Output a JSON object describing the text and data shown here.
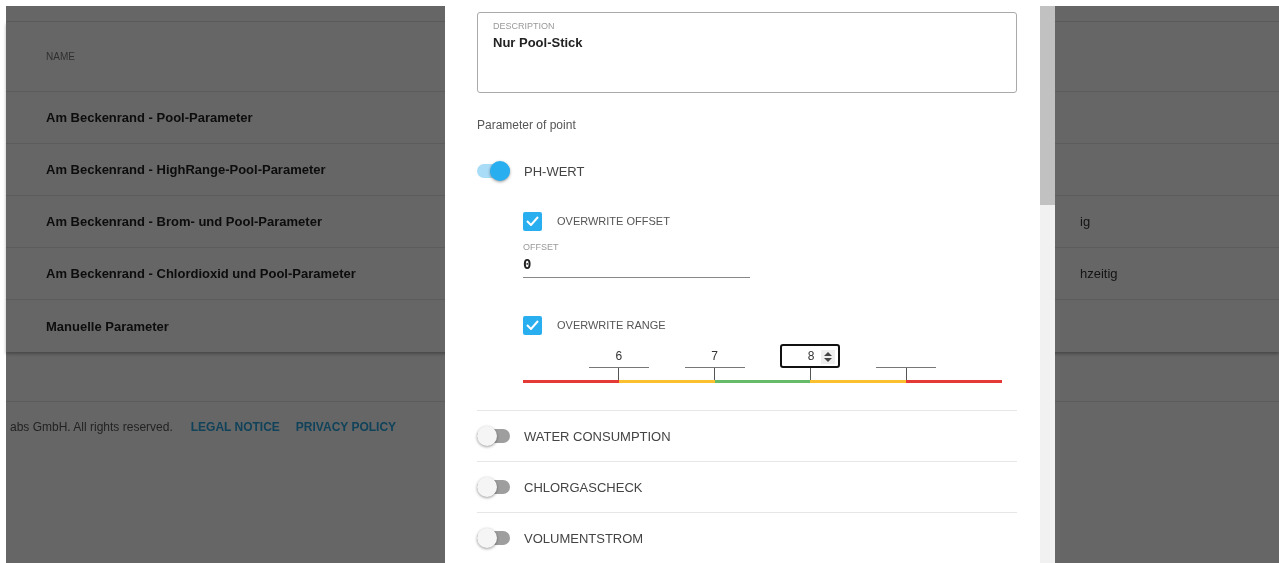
{
  "background_table": {
    "columns": [
      "NAME"
    ],
    "rows": [
      {
        "name": "Am Beckenrand - Pool-Parameter"
      },
      {
        "name": "Am Beckenrand - HighRange-Pool-Parameter"
      },
      {
        "name": "Am Beckenrand - Brom- und Pool-Parameter",
        "column_2": "ig"
      },
      {
        "name": "Am Beckenrand - Chlordioxid und Pool-Parameter",
        "column_2": "hzeitig"
      },
      {
        "name": "Manuelle Parameter"
      }
    ]
  },
  "footer": {
    "copyright": "abs GmbH. All rights reserved.",
    "links": [
      "LEGAL NOTICE",
      "PRIVACY POLICY"
    ]
  },
  "dialog": {
    "description": {
      "label": "DESCRIPTION",
      "value": "Nur Pool-Stick"
    },
    "section_label": "Parameter of point",
    "parameters": [
      {
        "name": "PH-WERT",
        "on": true,
        "overwrite_offset": {
          "label": "OVERWRITE OFFSET",
          "checked": true
        },
        "offset": {
          "label": "OFFSET",
          "value": "0"
        },
        "overwrite_range": {
          "label": "OVERWRITE RANGE",
          "checked": true
        },
        "range": {
          "thresholds": [
            {
              "value": "6",
              "focused": false
            },
            {
              "value": "7",
              "focused": false
            },
            {
              "value": "8",
              "focused": true
            },
            {
              "focused": false
            }
          ],
          "segments": [
            {
              "color": "#e53935"
            },
            {
              "color": "#fbc02d"
            },
            {
              "color": "#66bb6a"
            },
            {
              "color": "#fbc02d"
            },
            {
              "color": "#e53935"
            }
          ]
        }
      },
      {
        "name": "WATER CONSUMPTION",
        "on": false
      },
      {
        "name": "CHLORGASCHECK",
        "on": false
      },
      {
        "name": "VOLUMENTSTROM",
        "on": false
      }
    ]
  }
}
